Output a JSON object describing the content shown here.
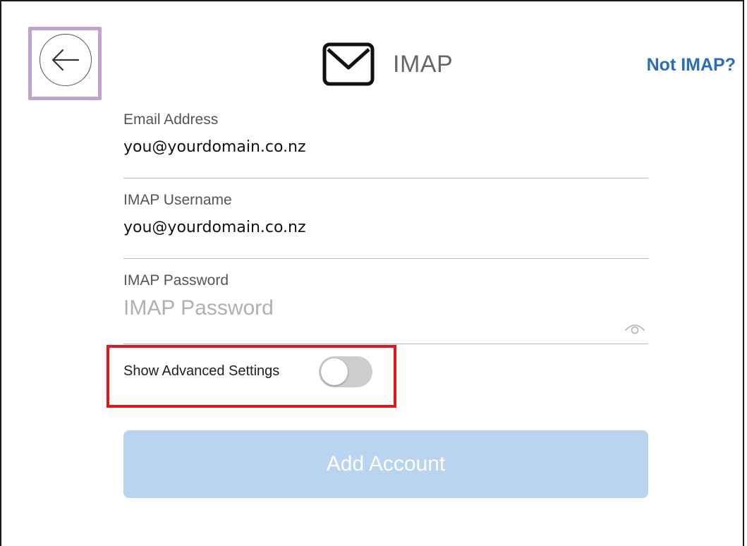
{
  "header": {
    "title": "IMAP",
    "not_imap_label": "Not IMAP?",
    "back_icon": "back-arrow-icon",
    "mail_icon": "envelope-icon"
  },
  "form": {
    "email": {
      "label": "Email Address",
      "value": "you@yourdomain.co.nz"
    },
    "username": {
      "label": "IMAP Username",
      "value": "you@yourdomain.co.nz"
    },
    "password": {
      "label": "IMAP Password",
      "placeholder": "IMAP Password",
      "value": "",
      "eye_icon": "eye-icon"
    },
    "advanced": {
      "label": "Show Advanced Settings",
      "enabled": false
    },
    "submit_label": "Add Account"
  },
  "colors": {
    "link": "#2a6db8",
    "button_disabled": "#b9d4ef",
    "toggle_off": "#cdcdcd",
    "highlight_red": "#e3141a",
    "highlight_purple": "#c2a3cd"
  }
}
